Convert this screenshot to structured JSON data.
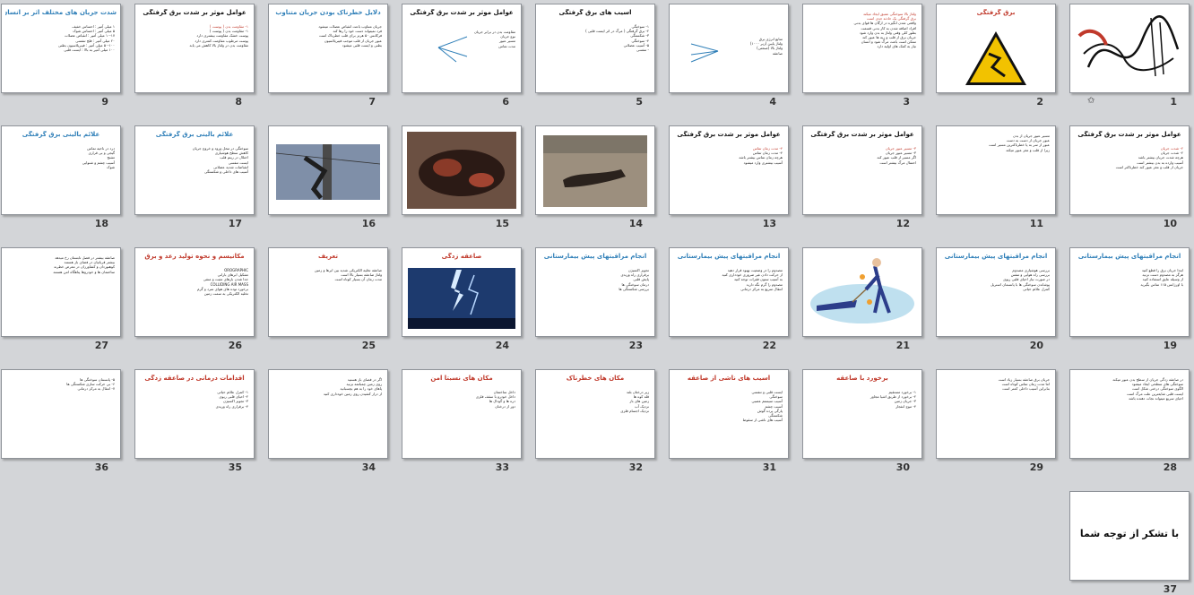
{
  "slides": [
    {
      "num": "1",
      "title": "",
      "kind": "calligraphy",
      "star": "✩",
      "logo_text": "بسم الله الرحمن الرحیم",
      "lines": []
    },
    {
      "num": "2",
      "title": "برق گرفتگی",
      "color": "red",
      "kind": "warning",
      "lines": []
    },
    {
      "num": "3",
      "title": "",
      "kind": "text",
      "lines": [
        "واقعی شدن انگیزه در ارگان ها قوای بدنی",
        "افراد اضافه شدن به کار بدنی قسمت",
        "بطور کلی وقتی ولتاژ به بدن وارد شود",
        "جریان برق از قلب و ریه ها عبور کند",
        "ممکن است باعث مرگ شود و انسان",
        "نیاز به کمک های اولیه دارد"
      ],
      "red_lines": [
        "ولتاژ بالا سوختگی عمیق ایجاد میکند",
        "برق گرفتگی یک حادثه جدی است"
      ]
    },
    {
      "num": "4",
      "title": "",
      "kind": "arrows4",
      "lines": [
        "منابع انرژی برق",
        "ولتاژ پایین (زیر ۱۰۰۰)",
        "ولتاژ بالا (صنعتی)",
        "صاعقه"
      ]
    },
    {
      "num": "5",
      "title": "آسیب های برق گرفتگی",
      "kind": "text",
      "lines": [
        "۱- سوختگی",
        "۲- برق گرفتگی ( مرگ در اثر ایست قلبی )",
        "۳- شکستگی",
        "۴- سوختگی",
        "۵- آسیب عضلانی",
        "- تنفسی"
      ]
    },
    {
      "num": "6",
      "title": "عوامل موثر بر شدت برق گرفتگی",
      "kind": "arrows6",
      "lines": [
        "مقاومت بدن در برابر جریان",
        "نوع جریان",
        "مسیر عبور",
        "مدت تماس"
      ]
    },
    {
      "num": "7",
      "title": "دلایل خطرناک بودن جریان متناوب",
      "color": "blue",
      "kind": "text",
      "lines": [
        "جریان متناوب باعث انقباض عضلات میشود",
        "فرد نمیتواند دست خود را رها کند",
        "فرکانس ۵۰ هرتز برای قلب خطرناک است",
        "عبور جریان از قلب موجب فیبریلاسیون",
        "بطنی و ایست قلبی میشود"
      ]
    },
    {
      "num": "8",
      "title": "عوامل موثر بر شدت برق گرفتگی",
      "kind": "text",
      "lines": [
        "۱- مقاومت بدن ( پوست )",
        "پوست خشک مقاومت بیشتری دارد",
        "پوست مرطوب مقاومت کمتری دارد",
        "مقاومت بدن در ولتاژ بالا کاهش می یابد"
      ],
      "red_lines": [
        "۱- مقاومت بدن ( پوست )"
      ]
    },
    {
      "num": "9",
      "title": "شدت جریان های مختلف اثر بر انسان",
      "color": "blue",
      "kind": "text",
      "lines": [
        "۱ میلی آمپر : احساس خفیف",
        "۵ میلی آمپر : احساس شوک",
        "۱۰-۱۷ میلی آمپر : انقباض عضلات",
        "۲۰ میلی آمپر : فلج تنفسی",
        "۵۰-۱۰۰ میلی آمپر : فیبریلاسیون بطنی",
        "۱۰۰ میلی آمپر به بالا : ایست قلبی"
      ]
    },
    {
      "num": "10",
      "title": "عوامل موثر بر شدت برق گرفتگی",
      "kind": "text",
      "lines": [
        "۲- شدت جریان",
        "هرچه شدت جریان بیشتر باشد",
        "آسیب وارده به بدن بیشتر است",
        "جریان از قلب و مغز عبور کند خطرناکتر است"
      ],
      "red_lines": [
        "۲- شدت جریان"
      ]
    },
    {
      "num": "11",
      "title": "",
      "kind": "text",
      "lines": [
        "مسیر عبور جریان از بدن",
        "عبور جریان از دست به دست",
        "عبور از سر به پا خطرناکترین مسیر است",
        "زیرا از قلب و مغز عبور میکند"
      ]
    },
    {
      "num": "12",
      "title": "عوامل موثر بر شدت برق گرفتگی",
      "kind": "text",
      "lines": [
        "۳- مسیر عبور جریان",
        "اگر مسیر از قلب عبور کند",
        "احتمال مرگ بیشتر است"
      ],
      "red_lines": [
        "۳- مسیر عبور جریان"
      ]
    },
    {
      "num": "13",
      "title": "عوامل موثر بر شدت برق گرفتگی",
      "kind": "text",
      "lines": [
        "۴- مدت زمان تماس",
        "هرچه زمان تماس بیشتر باشد",
        "آسیب بیشتری وارد میشود"
      ],
      "red_lines": [
        "۴- مدت زمان تماس"
      ]
    },
    {
      "num": "14",
      "title": "",
      "kind": "photo_lying",
      "lines": []
    },
    {
      "num": "15",
      "title": "",
      "kind": "photo_burn",
      "lines": []
    },
    {
      "num": "16",
      "title": "",
      "kind": "photo_pole",
      "lines": []
    },
    {
      "num": "17",
      "title": "علائم بالینی برق گرفتگی",
      "color": "blue",
      "kind": "text",
      "lines": [
        "سوختگی در محل ورود و خروج جریان",
        "کاهش سطح هوشیاری",
        "اختلال در ریتم قلب",
        "ایست تنفسی",
        "انقباضات شدید عضلانی",
        "آسیب های داخلی و شکستگی"
      ]
    },
    {
      "num": "18",
      "title": "علائم بالینی برق گرفتگی",
      "color": "blue",
      "kind": "text",
      "lines": [
        "درد در ناحیه تماس",
        "گیجی و بی قراری",
        "تشنج",
        "آسیب چشم و شنوایی",
        "شوک"
      ]
    },
    {
      "num": "19",
      "title": "انجام مراقبتهای پیش بیمارستانی",
      "color": "blue",
      "kind": "text",
      "lines": [
        "ابتدا جریان برق را قطع کنید",
        "هرگز به مصدوم دست نزنید",
        "از وسیله عایق استفاده کنید",
        "با اورژانس ۱۱۵ تماس بگیرید"
      ]
    },
    {
      "num": "20",
      "title": "انجام مراقبتهای پیش بیمارستانی",
      "color": "blue",
      "kind": "text",
      "lines": [
        "بررسی هوشیاری مصدوم",
        "بررسی راه هوایی و تنفس",
        "در صورت نیاز احیای قلبی ریوی",
        "پوشاندن سوختگی ها با پانسمان استریل",
        "کنترل علائم حیاتی"
      ]
    },
    {
      "num": "21",
      "title": "",
      "kind": "rescue",
      "lines": []
    },
    {
      "num": "22",
      "title": "انجام مراقبتهای پیش بیمارستانی",
      "color": "blue",
      "kind": "text",
      "lines": [
        "مصدوم را در وضعیت بهبود قرار دهید",
        "از حرکت دادن غیر ضروری خودداری کنید",
        "به آسیب ستون فقرات توجه کنید",
        "مصدوم را گرم نگه دارید",
        "انتقال سریع به مرکز درمانی"
      ]
    },
    {
      "num": "23",
      "title": "انجام مراقبتهای پیش بیمارستانی",
      "color": "blue",
      "kind": "text",
      "lines": [
        "تجویز اکسیژن",
        "برقراری راه وریدی",
        "پایش قلبی",
        "درمان سوختگی ها",
        "بررسی شکستگی ها"
      ]
    },
    {
      "num": "24",
      "title": "صاعقه زدگی",
      "color": "red",
      "kind": "lightning",
      "lines": []
    },
    {
      "num": "25",
      "title": "تعریف",
      "color": "red",
      "kind": "text",
      "lines": [
        "صاعقه تخلیه الکتریکی شدید بین ابرها و زمین",
        "ولتاژ صاعقه بسیار بالا است",
        "مدت زمان آن بسیار کوتاه است"
      ]
    },
    {
      "num": "26",
      "title": "مکانیسم و نحوه تولید رعد و برق",
      "color": "red",
      "kind": "text",
      "lines": [
        "OROGRAPHIC",
        "تشکیل ابرهای بارانی",
        "جدا شدن بارهای مثبت و منفی",
        "COLLIDING AIR MASS",
        "برخورد توده های هوای سرد و گرم",
        "تخلیه الکتریکی به سمت زمین"
      ]
    },
    {
      "num": "27",
      "title": "",
      "kind": "text",
      "lines": [
        "صاعقه بیشتر در فصل تابستان رخ میدهد",
        "بیشتر قربانیان در فضای باز هستند",
        "کوهنوردان و کشاورزان در معرض خطرند",
        "ساختمان ها و خودروها پناهگاه امن هستند"
      ]
    },
    {
      "num": "28",
      "title": "",
      "kind": "text",
      "lines": [
        "در صاعقه زدگی جریان از سطح بدن عبور میکند",
        "سوختگی های سطحی ایجاد میشود",
        "الگوی سوختگی درختی شکل است",
        "ایست قلبی شایعترین علت مرگ است",
        "احیای سریع میتواند نجات دهنده باشد"
      ]
    },
    {
      "num": "29",
      "title": "",
      "kind": "text",
      "lines": [
        "جریان برق صاعقه بسیار زیاد است",
        "اما مدت زمان تماس کوتاه است",
        "بنابراین آسیب داخلی کمتر است"
      ]
    },
    {
      "num": "30",
      "title": "برخورد با صاعقه",
      "color": "red",
      "kind": "text",
      "lines": [
        "۱- برخورد مستقیم",
        "۲- برخورد از طریق اشیا مجاور",
        "۳- جریان زمین",
        "۴- موج انفجار"
      ]
    },
    {
      "num": "31",
      "title": "آسیب های ناشی از صاعقه",
      "color": "red",
      "kind": "text",
      "lines": [
        "ایست قلبی و تنفسی",
        "سوختگی",
        "آسیب سیستم عصبی",
        "آسیب چشم",
        "پارگی پرده گوش",
        "شکستگی",
        "آسیب های ناشی از سقوط"
      ]
    },
    {
      "num": "32",
      "title": "مکان های خطرناک",
      "color": "red",
      "kind": "text",
      "lines": [
        "زیر درختان بلند",
        "قله کوه ها",
        "زمین های باز",
        "نزدیک آب",
        "نزدیک اجسام فلزی"
      ]
    },
    {
      "num": "33",
      "title": "مکان های نسبتا امن",
      "color": "red",
      "kind": "text",
      "lines": [
        "داخل ساختمان",
        "داخل خودرو با سقف فلزی",
        "دره ها و گودال ها",
        "دور از درختان"
      ]
    },
    {
      "num": "34",
      "title": "",
      "kind": "text",
      "lines": [
        "اگر در فضای باز هستید",
        "روی زمین چمباتمه بزنید",
        "پاهای خود را به هم بچسبانید",
        "از دراز کشیدن روی زمین خودداری کنید"
      ]
    },
    {
      "num": "35",
      "title": "اقدامات درمانی در صاعقه زدگی",
      "color": "red",
      "kind": "text",
      "lines": [
        "۱- کنترل علائم حیاتی",
        "۲- احیای قلبی ریوی",
        "۳- تجویز اکسیژن",
        "۴- برقراری راه وریدی"
      ]
    },
    {
      "num": "36",
      "title": "",
      "kind": "text",
      "lines": [
        "۵- پانسمان سوختگی ها",
        "۶- بی حرکت سازی شکستگی ها",
        "۷- انتقال به مرکز درمانی"
      ]
    },
    {
      "num": "37",
      "title": "",
      "kind": "thanks",
      "thanks": "با تشکر از توجه شما",
      "lines": []
    }
  ]
}
